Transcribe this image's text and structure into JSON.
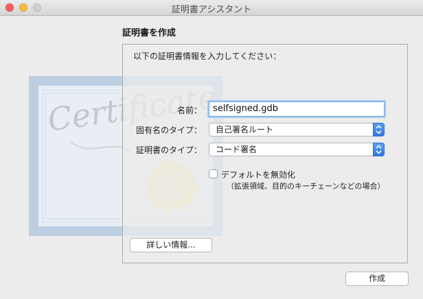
{
  "window": {
    "title": "証明書アシスタント"
  },
  "heading": "証明書を作成",
  "intro": "以下の証明書情報を入力してください：",
  "certificate_art": {
    "text": "Certificate"
  },
  "form": {
    "name_label": "名前：",
    "name_value": "selfsigned.gdb",
    "identity_type_label": "固有名のタイプ：",
    "identity_type_value": "自己署名ルート",
    "cert_type_label": "証明書のタイプ：",
    "cert_type_value": "コード署名",
    "override_label": "デフォルトを無効化",
    "override_note": "（拡張領域、目的のキーチェーンなどの場合）",
    "override_checked": false
  },
  "buttons": {
    "details": "詳しい情報...",
    "create": "作成"
  },
  "colors": {
    "accent": "#2f77e6",
    "focus": "#a6c8f4"
  }
}
